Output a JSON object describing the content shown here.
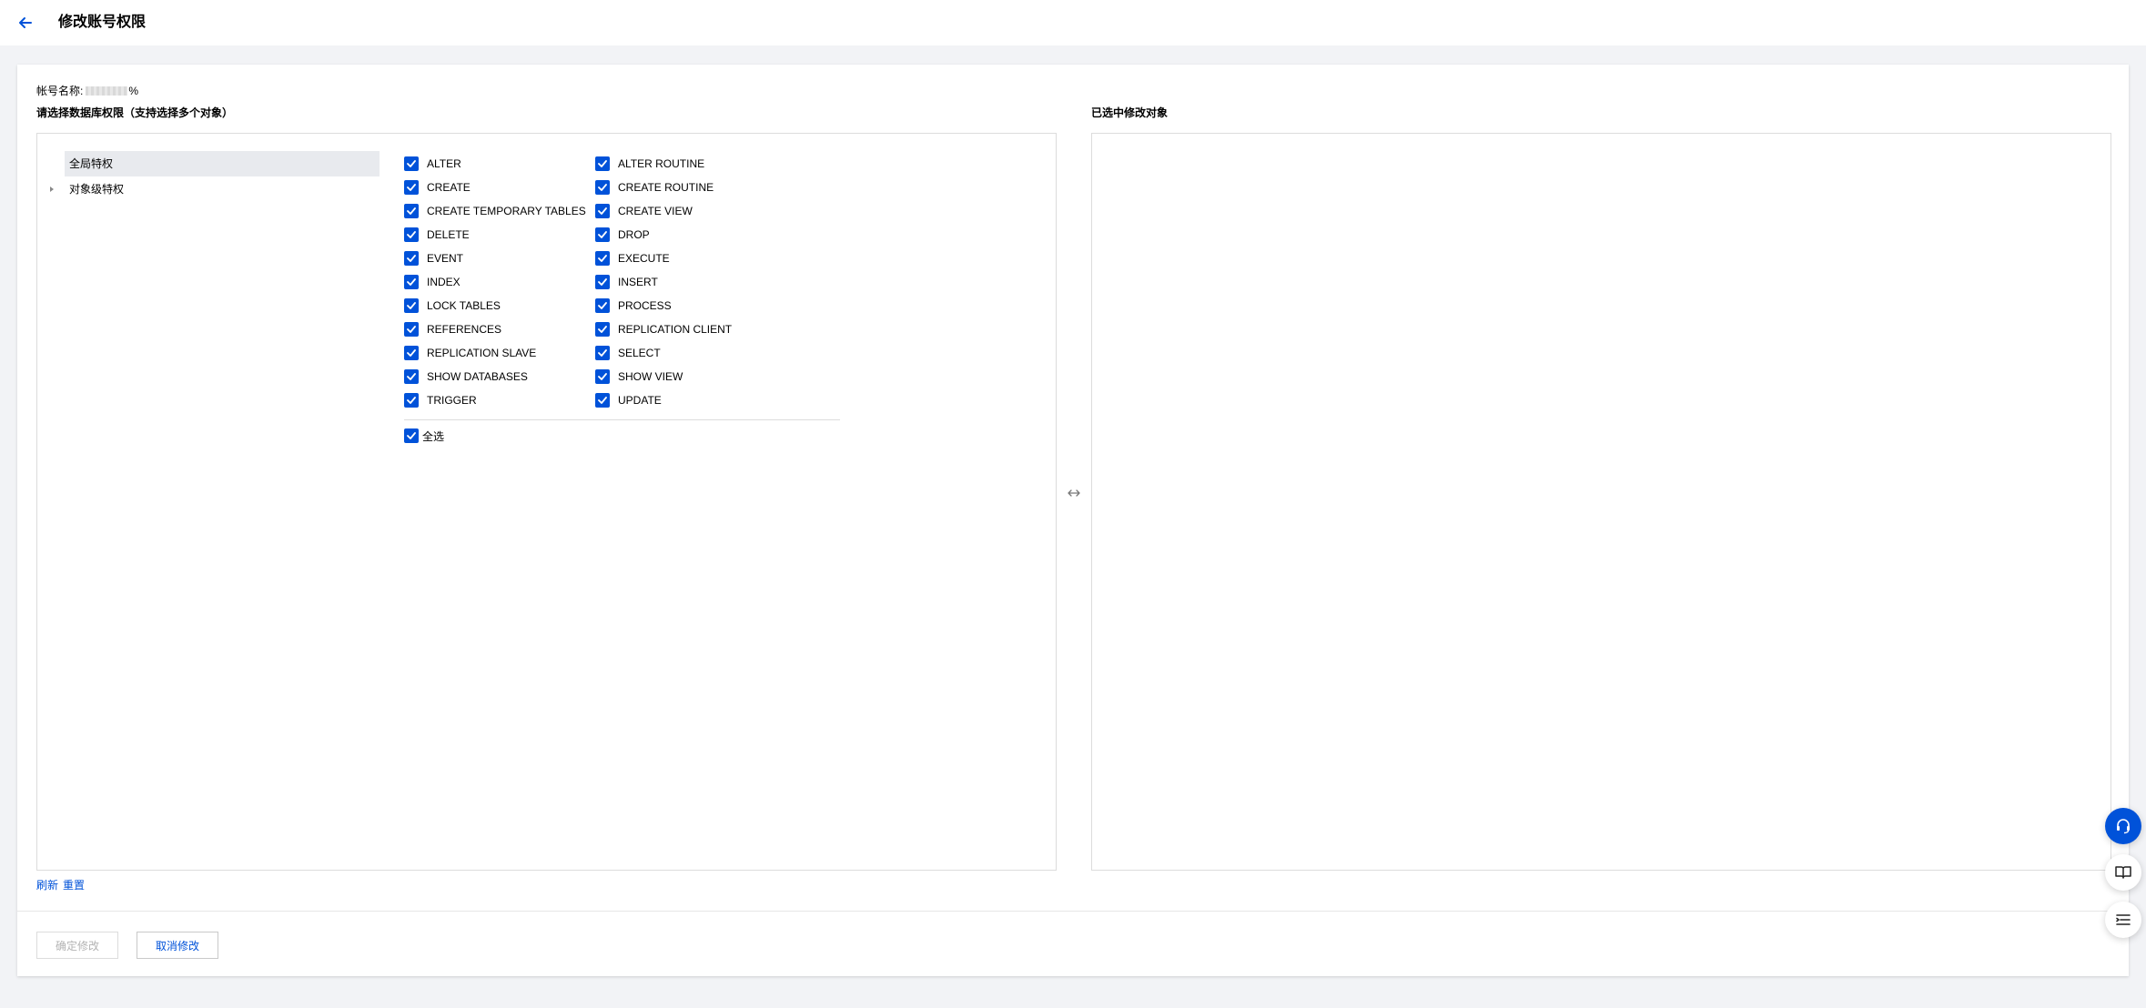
{
  "header": {
    "title": "修改账号权限"
  },
  "account": {
    "label": "帐号名称:",
    "host_suffix": "%"
  },
  "left_section": {
    "title": "请选择数据库权限（支持选择多个对象）",
    "tree": [
      {
        "label": "全局特权",
        "selected": true
      },
      {
        "label": "对象级特权",
        "selected": false
      }
    ]
  },
  "permissions": {
    "col1": [
      "ALTER",
      "CREATE",
      "CREATE TEMPORARY TABLES",
      "DELETE",
      "EVENT",
      "INDEX",
      "LOCK TABLES",
      "REFERENCES",
      "REPLICATION SLAVE",
      "SHOW DATABASES",
      "TRIGGER"
    ],
    "col2": [
      "ALTER ROUTINE",
      "CREATE ROUTINE",
      "CREATE VIEW",
      "DROP",
      "EXECUTE",
      "INSERT",
      "PROCESS",
      "REPLICATION CLIENT",
      "SELECT",
      "SHOW VIEW",
      "UPDATE"
    ],
    "checked": true,
    "select_all_label": "全选"
  },
  "right_section": {
    "title": "已选中修改对象"
  },
  "links": {
    "refresh": "刷新",
    "reset": "重置"
  },
  "buttons": {
    "confirm": "确定修改",
    "cancel": "取消修改"
  },
  "colors": {
    "primary": "#0052d9",
    "border": "#dcdcdc",
    "page_bg": "#f2f3f6"
  },
  "icons": {
    "back": "arrow-left-icon",
    "swap": "swap-horizontal-icon",
    "support": "headset-icon",
    "docs": "book-icon",
    "menu": "list-icon"
  }
}
